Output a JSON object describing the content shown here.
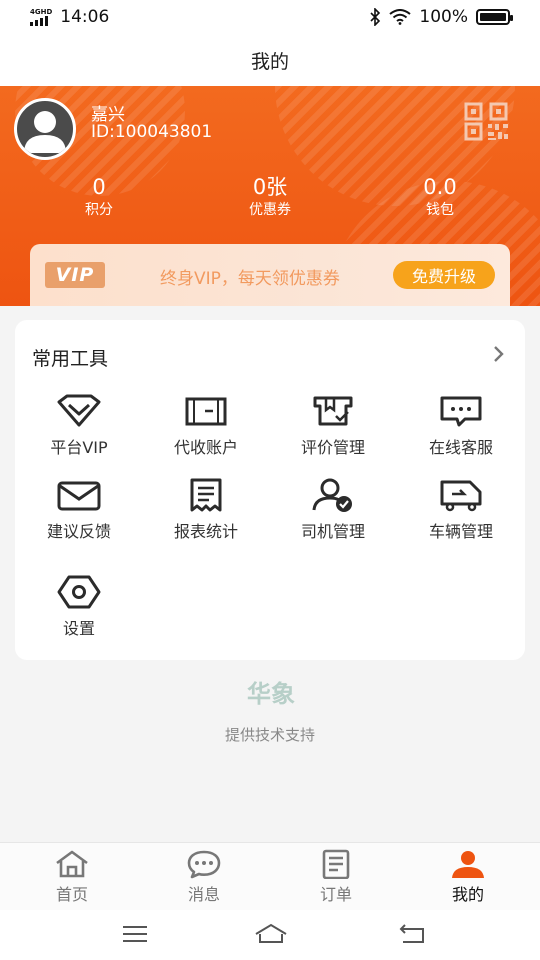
{
  "status_bar": {
    "network": "4GHD",
    "time": "14:06",
    "battery": "100%"
  },
  "nav": {
    "title": "我的"
  },
  "profile": {
    "name": "嘉兴",
    "id": "ID:100043801"
  },
  "stats": [
    {
      "value": "0",
      "label": "积分"
    },
    {
      "value": "0张",
      "label": "优惠券"
    },
    {
      "value": "0.0",
      "label": "钱包"
    }
  ],
  "vip": {
    "badge": "VIP",
    "text": "终身VIP，每天领优惠券",
    "button": "免费升级"
  },
  "tools": {
    "title": "常用工具",
    "items": [
      {
        "label": "平台VIP",
        "icon": "diamond-icon"
      },
      {
        "label": "代收账户",
        "icon": "wallet-icon"
      },
      {
        "label": "评价管理",
        "icon": "rating-box-icon"
      },
      {
        "label": "在线客服",
        "icon": "chat-bubble-icon"
      },
      {
        "label": "建议反馈",
        "icon": "envelope-icon"
      },
      {
        "label": "报表统计",
        "icon": "receipt-icon"
      },
      {
        "label": "司机管理",
        "icon": "driver-check-icon"
      },
      {
        "label": "车辆管理",
        "icon": "truck-icon"
      },
      {
        "label": "设置",
        "icon": "settings-hex-icon"
      }
    ]
  },
  "footer": {
    "brand": "华象",
    "support": "提供技术支持"
  },
  "tabbar": {
    "items": [
      {
        "label": "首页",
        "icon": "home-icon",
        "active": false
      },
      {
        "label": "消息",
        "icon": "message-icon",
        "active": false
      },
      {
        "label": "订单",
        "icon": "order-icon",
        "active": false
      },
      {
        "label": "我的",
        "icon": "person-icon",
        "active": true
      }
    ]
  },
  "colors": {
    "accent": "#ee5411",
    "vip_button": "#f7a31b",
    "vip_badge": "#e9a06b",
    "vip_text": "#f29a5f",
    "brand_logo": "#b7cfc8"
  }
}
